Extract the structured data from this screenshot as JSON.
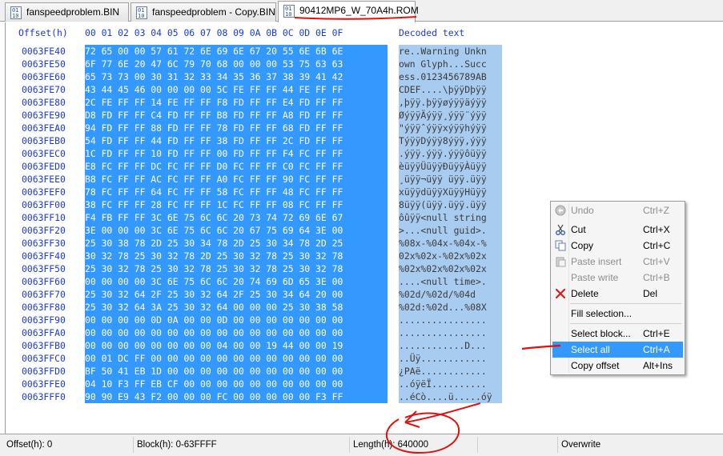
{
  "tabs": [
    {
      "label": "fanspeedproblem.BIN"
    },
    {
      "label": "fanspeedproblem - Copy.BIN"
    },
    {
      "label": "90412MP6_W_70A4h.ROM"
    }
  ],
  "hex_view": {
    "offset_header": "Offset(h)",
    "column_header": "00 01 02 03 04 05 06 07 08 09 0A 0B 0C 0D 0E 0F",
    "text_header": "Decoded text",
    "rows": [
      {
        "offset": "0063FE40",
        "hex": "72 65 00 00 57 61 72 6E 69 6E 67 20 55 6E 6B 6E",
        "text": "re..Warning Unkn"
      },
      {
        "offset": "0063FE50",
        "hex": "6F 77 6E 20 47 6C 79 70 68 00 00 00 53 75 63 63",
        "text": "own Glyph...Succ"
      },
      {
        "offset": "0063FE60",
        "hex": "65 73 73 00 30 31 32 33 34 35 36 37 38 39 41 42",
        "text": "ess.0123456789AB"
      },
      {
        "offset": "0063FE70",
        "hex": "43 44 45 46 00 00 00 00 5C FE FF FF 44 FE FF FF",
        "text": "CDEF....\\þÿÿDþÿÿ"
      },
      {
        "offset": "0063FE80",
        "hex": "2C FE FF FF 14 FE FF FF F8 FD FF FF E4 FD FF FF",
        "text": ",þÿÿ.þÿÿøýÿÿäýÿÿ"
      },
      {
        "offset": "0063FE90",
        "hex": "D8 FD FF FF C4 FD FF FF B8 FD FF FF A8 FD FF FF",
        "text": "ØýÿÿÄýÿÿ¸ýÿÿ¨ýÿÿ"
      },
      {
        "offset": "0063FEA0",
        "hex": "94 FD FF FF 88 FD FF FF 78 FD FF FF 68 FD FF FF",
        "text": "\"ýÿÿˆýÿÿxýÿÿhýÿÿ"
      },
      {
        "offset": "0063FEB0",
        "hex": "54 FD FF FF 44 FD FF FF 38 FD FF FF 2C FD FF FF",
        "text": "TýÿÿDýÿÿ8ýÿÿ,ýÿÿ"
      },
      {
        "offset": "0063FEC0",
        "hex": "1C FD FF FF 10 FD FF FF 00 FD FF FF F4 FC FF FF",
        "text": ".ýÿÿ.ýÿÿ.ýÿÿôüÿÿ"
      },
      {
        "offset": "0063FED0",
        "hex": "E8 FC FF FF DC FC FF FF D0 FC FF FF C0 FC FF FF",
        "text": "èüÿÿÜüÿÿÐüÿÿÀüÿÿ"
      },
      {
        "offset": "0063FEE0",
        "hex": "B8 FC FF FF AC FC FF FF A0 FC FF FF 90 FC FF FF",
        "text": "¸üÿÿ¬üÿÿ üÿÿ.üÿÿ"
      },
      {
        "offset": "0063FEF0",
        "hex": "78 FC FF FF 64 FC FF FF 58 FC FF FF 48 FC FF FF",
        "text": "xüÿÿdüÿÿXüÿÿHüÿÿ"
      },
      {
        "offset": "0063FF00",
        "hex": "38 FC FF FF 28 FC FF FF 1C FC FF FF 08 FC FF FF",
        "text": "8üÿÿ(üÿÿ.üÿÿ.üÿÿ"
      },
      {
        "offset": "0063FF10",
        "hex": "F4 FB FF FF 3C 6E 75 6C 6C 20 73 74 72 69 6E 67",
        "text": "ôûÿÿ<null string"
      },
      {
        "offset": "0063FF20",
        "hex": "3E 00 00 00 3C 6E 75 6C 6C 20 67 75 69 64 3E 00",
        "text": ">...<null guid>."
      },
      {
        "offset": "0063FF30",
        "hex": "25 30 38 78 2D 25 30 34 78 2D 25 30 34 78 2D 25",
        "text": "%08x-%04x-%04x-%"
      },
      {
        "offset": "0063FF40",
        "hex": "30 32 78 25 30 32 78 2D 25 30 32 78 25 30 32 78",
        "text": "02x%02x-%02x%02x"
      },
      {
        "offset": "0063FF50",
        "hex": "25 30 32 78 25 30 32 78 25 30 32 78 25 30 32 78",
        "text": "%02x%02x%02x%02x"
      },
      {
        "offset": "0063FF60",
        "hex": "00 00 00 00 3C 6E 75 6C 6C 20 74 69 6D 65 3E 00",
        "text": "....<null time>."
      },
      {
        "offset": "0063FF70",
        "hex": "25 30 32 64 2F 25 30 32 64 2F 25 30 34 64 20 00",
        "text": "%02d/%02d/%04d"
      },
      {
        "offset": "0063FF80",
        "hex": "25 30 32 64 3A 25 30 32 64 00 00 00 25 30 38 58",
        "text": "%02d:%02d...%08X"
      },
      {
        "offset": "0063FF90",
        "hex": "00 00 00 00 0D 0A 00 00 0D 00 00 00 00 00 00 00",
        "text": "................"
      },
      {
        "offset": "0063FFA0",
        "hex": "00 00 00 00 00 00 00 00 00 00 00 00 00 00 00 00",
        "text": "................"
      },
      {
        "offset": "0063FFB0",
        "hex": "00 00 00 00 00 00 00 00 04 00 00 19 44 00 00 19",
        "text": "............D..."
      },
      {
        "offset": "0063FFC0",
        "hex": "00 01 DC FF 00 00 00 00 00 00 00 00 00 00 00 00",
        "text": "..Üÿ............"
      },
      {
        "offset": "0063FFD0",
        "hex": "BF 50 41 EB 1D 00 00 00 00 00 00 00 00 00 00 00",
        "text": "¿PAë............"
      },
      {
        "offset": "0063FFE0",
        "hex": "04 10 F3 FF EB CF 00 00 00 00 00 00 00 00 00 00",
        "text": "..óÿëÏ.........."
      },
      {
        "offset": "0063FFF0",
        "hex": "90 90 E9 43 F2 00 00 00 FC 00 00 00 00 00 F3 FF",
        "text": "..éCò....ü.....óÿ"
      }
    ]
  },
  "context_menu": {
    "items": [
      {
        "label": "Undo",
        "shortcut": "Ctrl+Z",
        "icon": "undo-icon",
        "disabled": true
      },
      {
        "label": "Cut",
        "shortcut": "Ctrl+X",
        "icon": "scissors-icon",
        "disabled": false
      },
      {
        "label": "Copy",
        "shortcut": "Ctrl+C",
        "icon": "copy-icon",
        "disabled": false
      },
      {
        "label": "Paste insert",
        "shortcut": "Ctrl+V",
        "icon": "paste-icon",
        "disabled": true
      },
      {
        "label": "Paste write",
        "shortcut": "Ctrl+B",
        "icon": "",
        "disabled": true
      },
      {
        "label": "Delete",
        "shortcut": "Del",
        "icon": "delete-x-icon",
        "disabled": false
      },
      {
        "label": "Fill selection...",
        "shortcut": "",
        "icon": "",
        "disabled": false
      },
      {
        "label": "Select block...",
        "shortcut": "Ctrl+E",
        "icon": "",
        "disabled": false
      },
      {
        "label": "Select all",
        "shortcut": "Ctrl+A",
        "icon": "",
        "disabled": false,
        "highlighted": true
      },
      {
        "label": "Copy offset",
        "shortcut": "Alt+Ins",
        "icon": "",
        "disabled": false
      }
    ]
  },
  "status_bar": {
    "offset": "Offset(h): 0",
    "block": "Block(h): 0-63FFFF",
    "length": "Length(h): 640000",
    "mode": "Overwrite"
  },
  "colors": {
    "selection": "#3399ff",
    "text_selection": "#a8cbf0",
    "header_blue": "#1a3ad8",
    "annotation_red": "#e01010"
  }
}
